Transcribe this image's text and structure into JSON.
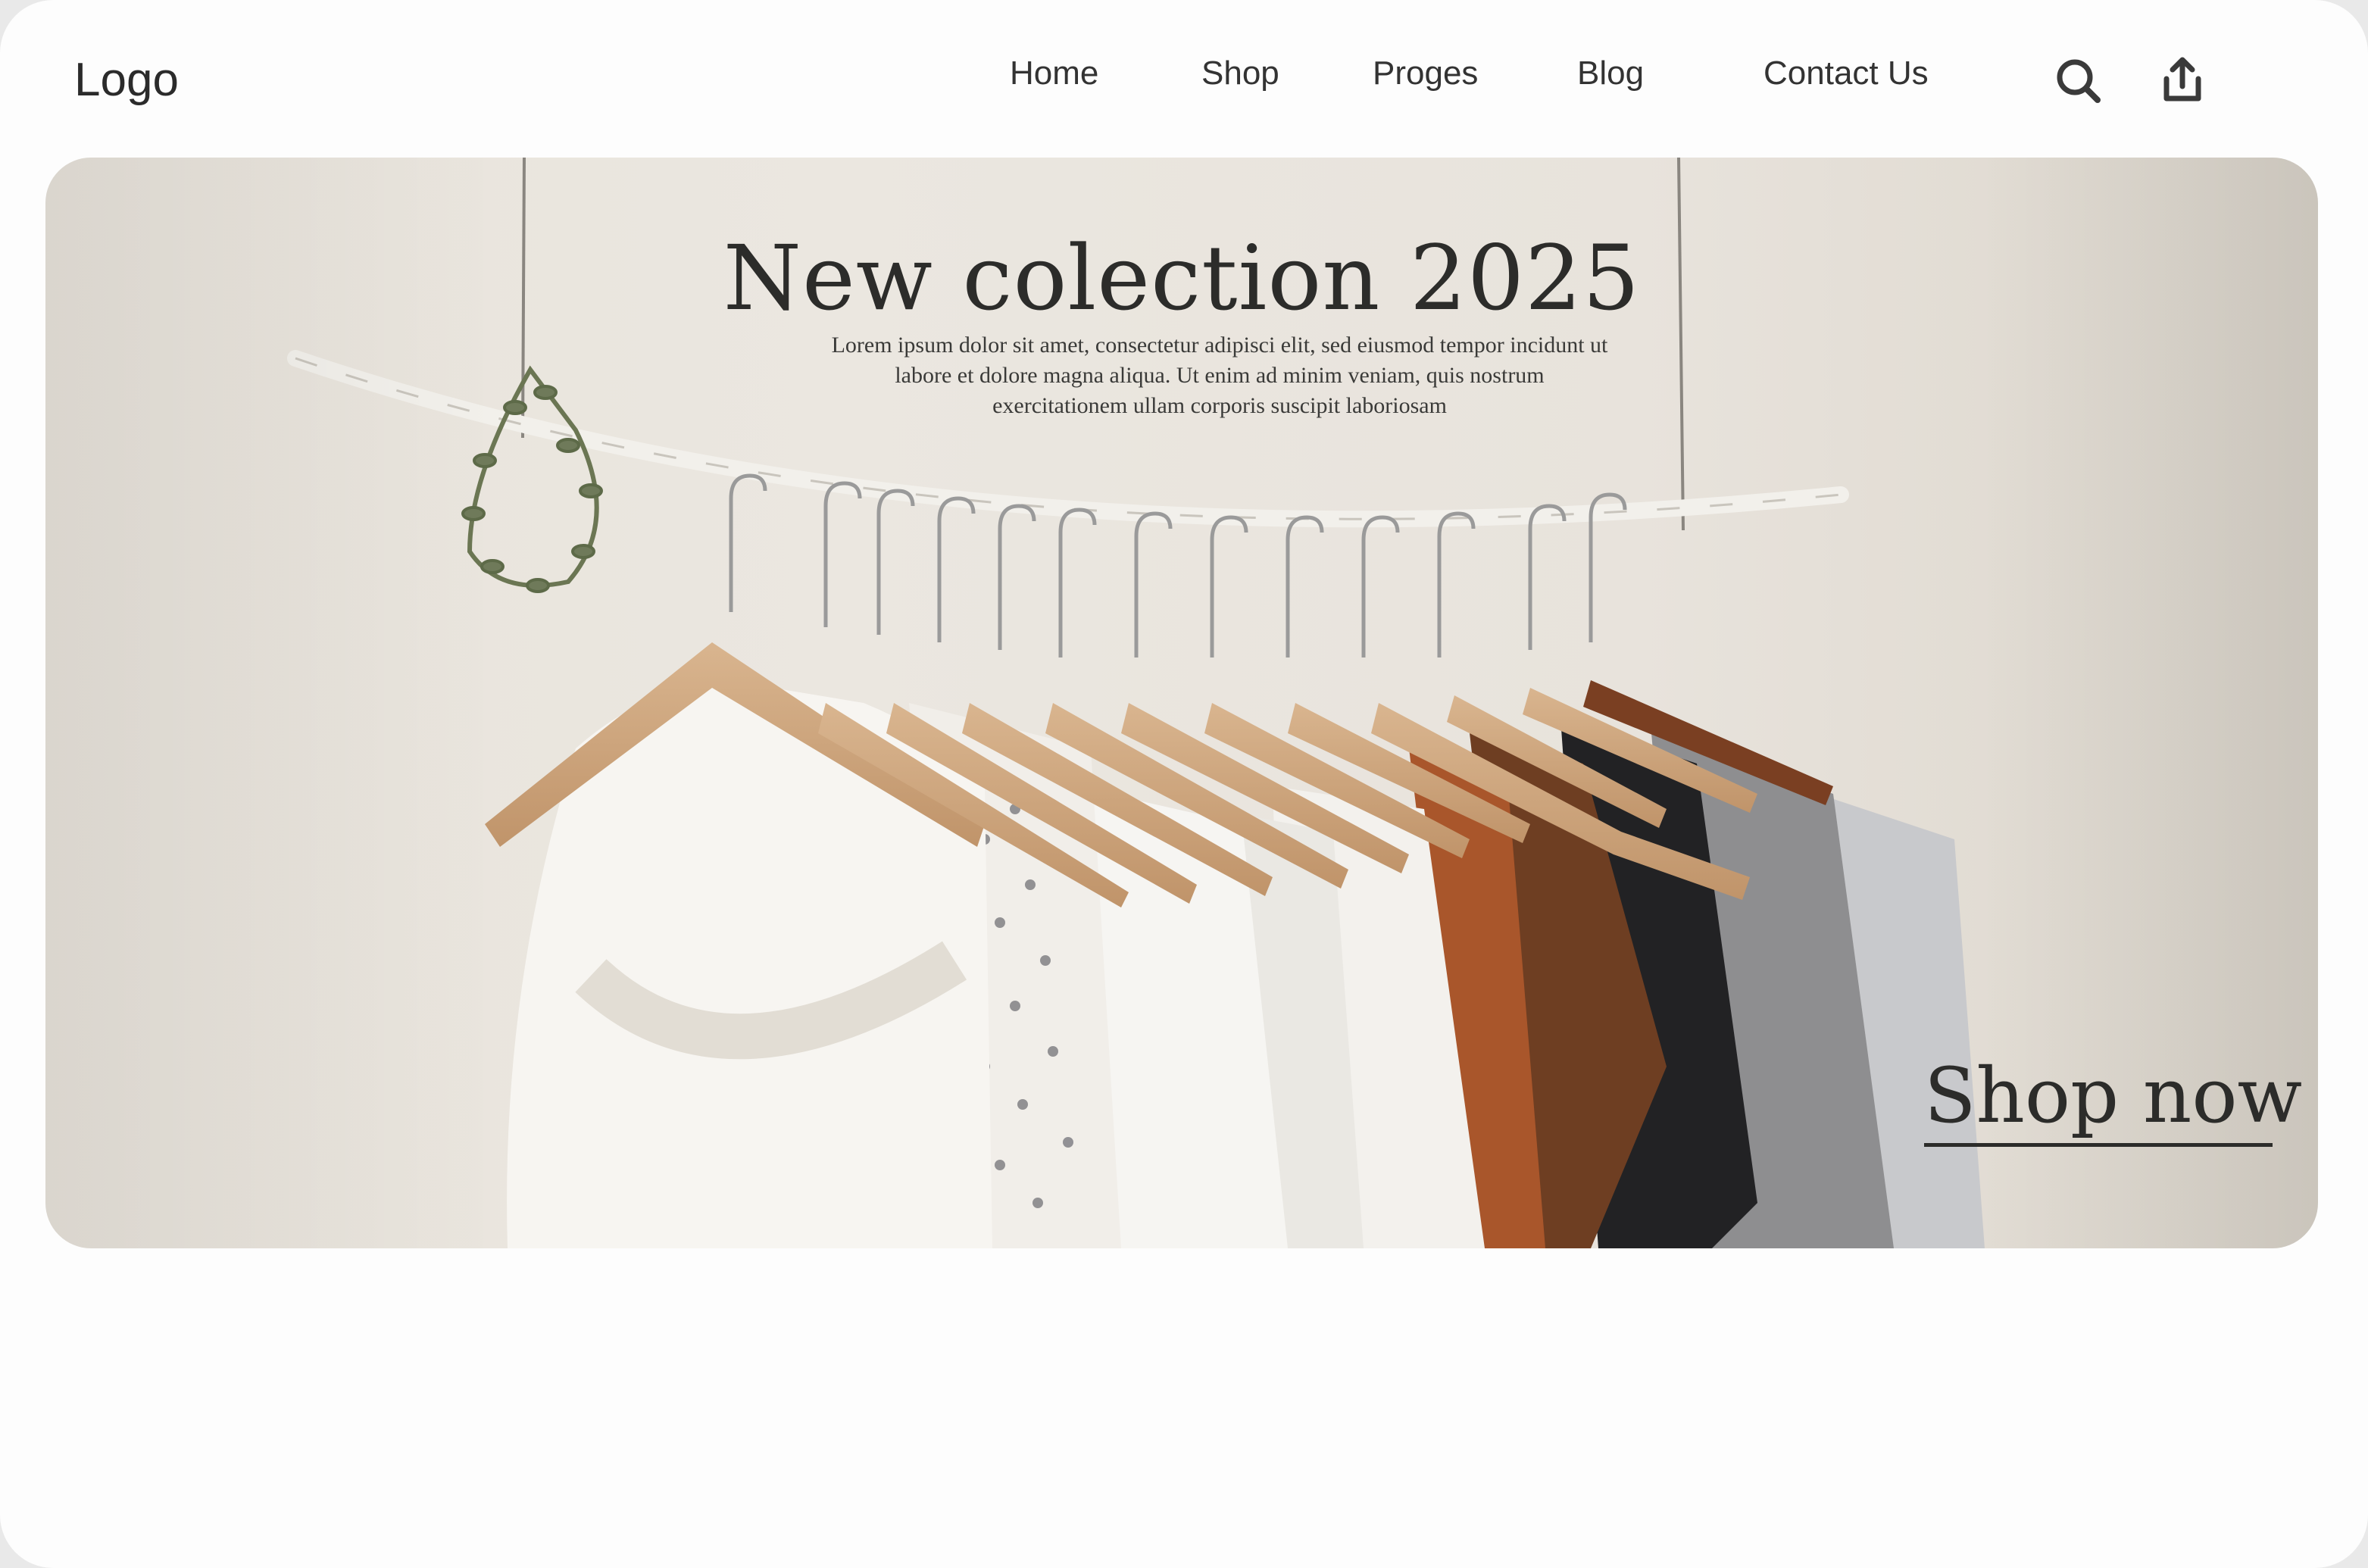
{
  "header": {
    "logo": "Logo",
    "nav": [
      "Home",
      "Shop",
      "Proges",
      "Blog",
      "Contact Us"
    ],
    "icons": [
      "search-icon",
      "share-icon"
    ]
  },
  "hero": {
    "title": "New colection 2025",
    "description": "Lorem ipsum dolor sit amet, consectetur adipisci elit, sed eiusmod tempor incidunt ut labore et dolore magna aliqua. Ut enim ad minim veniam, quis nostrum exercitationem ullam corporis suscipit laboriosam",
    "cta": "Shop now"
  },
  "colors": {
    "text": "#333333",
    "hero_bg": "#e8e3db",
    "page_bg": "#fdfdfd"
  }
}
